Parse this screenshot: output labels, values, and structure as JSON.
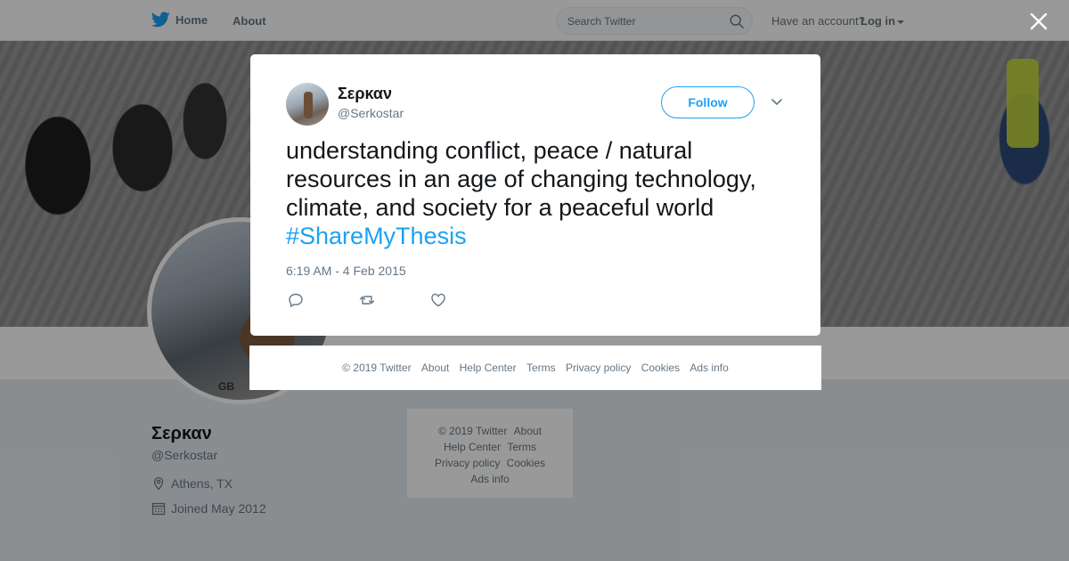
{
  "nav": {
    "home_label": "Home",
    "about_label": "About"
  },
  "search": {
    "placeholder": "Search Twitter"
  },
  "account": {
    "prompt": "Have an account?",
    "login_label": "Log in"
  },
  "profile": {
    "name": "Σερκαν",
    "handle": "@Serkostar",
    "location": "Athens, TX",
    "joined": "Joined May 2012",
    "avatar_text": "GB"
  },
  "side_footer": {
    "copyright": "© 2019 Twitter",
    "about": "About",
    "help_center": "Help Center",
    "terms": "Terms",
    "privacy": "Privacy policy",
    "cookies": "Cookies",
    "ads_info": "Ads info"
  },
  "tweet": {
    "name": "Σερκαν",
    "handle": "@Serkostar",
    "follow_label": "Follow",
    "text": "understanding conflict, peace / natural resources in an age of changing technology, climate, and society for a peaceful world",
    "hashtag": "#ShareMyThesis",
    "timestamp": "6:19 AM - 4 Feb 2015"
  },
  "modal_footer": {
    "copyright": "© 2019 Twitter",
    "about": "About",
    "help_center": "Help Center",
    "terms": "Terms",
    "privacy": "Privacy policy",
    "cookies": "Cookies",
    "ads_info": "Ads info"
  },
  "colors": {
    "brand": "#1da1f2",
    "text": "#14171a",
    "muted": "#657786"
  },
  "icons": [
    "twitter-bird-icon",
    "search-icon",
    "close-icon",
    "chevron-down-icon",
    "reply-icon",
    "retweet-icon",
    "like-icon",
    "location-icon",
    "calendar-icon"
  ]
}
